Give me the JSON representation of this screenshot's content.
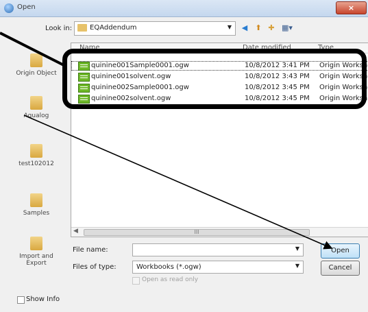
{
  "window": {
    "title": "Open",
    "close_glyph": "×"
  },
  "lookin": {
    "label": "Look in:",
    "value": "EQAddendum"
  },
  "toolbar": {
    "icons": [
      "back-icon",
      "up-folder-icon",
      "new-folder-icon",
      "views-menu-icon"
    ]
  },
  "places": [
    {
      "label": "Origin Object"
    },
    {
      "label": "Aqualog"
    },
    {
      "label": "test102012"
    },
    {
      "label": "Samples"
    },
    {
      "label": "Import and Export"
    }
  ],
  "columns": {
    "name": "Name",
    "date": "Date modified",
    "type": "Type"
  },
  "files": [
    {
      "name": "quinine001Sample0001.ogw",
      "date": "10/8/2012 3:41 PM",
      "type": "Origin Workshe"
    },
    {
      "name": "quinine001solvent.ogw",
      "date": "10/8/2012 3:43 PM",
      "type": "Origin Workshe"
    },
    {
      "name": "quinine002Sample0001.ogw",
      "date": "10/8/2012 3:45 PM",
      "type": "Origin Workshe"
    },
    {
      "name": "quinine002solvent.ogw",
      "date": "10/8/2012 3:45 PM",
      "type": "Origin Worksh"
    }
  ],
  "scrollbar": {
    "thumb_label": "III"
  },
  "filename": {
    "label": "File name:",
    "value": ""
  },
  "filetype": {
    "label": "Files of type:",
    "value": "Workbooks (*.ogw)"
  },
  "readonly": {
    "label": "Open as read only",
    "checked": false
  },
  "showinfo": {
    "label": "Show Info",
    "checked": false
  },
  "buttons": {
    "open": "Open",
    "cancel": "Cancel"
  },
  "colors": {
    "annotation": "#000000",
    "folder": "#e0b44f",
    "workbook": "#6fb82a"
  }
}
